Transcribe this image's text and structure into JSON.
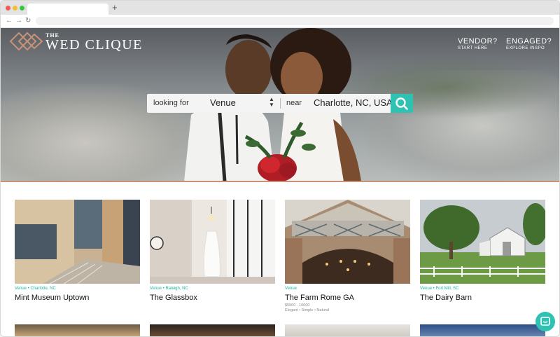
{
  "header": {
    "logo_the": "THE",
    "logo_name": "WED CLIQUE",
    "vendor_label": "VENDOR?",
    "vendor_sub": "START HERE",
    "engaged_label": "ENGAGED?",
    "engaged_sub": "EXPLORE INSPO"
  },
  "search": {
    "looking_label": "looking for",
    "category_value": "Venue",
    "near_label": "near",
    "location_value": "Charlotte, NC, USA",
    "button_icon": "search-icon"
  },
  "colors": {
    "accent": "#2fc2b3",
    "brand_copper": "#c79378"
  },
  "cards": [
    {
      "meta": "Venue • Charlotte, NC",
      "title": "Mint Museum Uptown"
    },
    {
      "meta": "Venue • Raleigh, NC",
      "title": "The Glassbox"
    },
    {
      "meta": "Venue",
      "title": "The Farm Rome GA",
      "price": "$5500 - 10000",
      "tags": "Elegant • Simple • Natural"
    },
    {
      "meta": "Venue • Fort Mill, SC",
      "title": "The Dairy Barn"
    }
  ]
}
